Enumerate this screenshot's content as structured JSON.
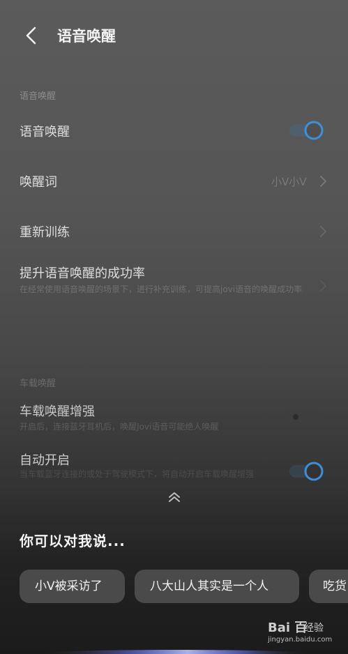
{
  "header": {
    "title": "语音唤醒"
  },
  "section_voice": {
    "label": "语音唤醒",
    "rows": [
      {
        "title": "语音唤醒",
        "toggle_on": true
      },
      {
        "title": "唤醒词",
        "value": "小V小V"
      },
      {
        "title": "重新训练"
      },
      {
        "title": "提升语音唤醒的成功率",
        "subtitle": "在经常使用语音唤醒的场景下，进行补充训练，可提高jovi语音的唤醒成功率"
      }
    ]
  },
  "section_car": {
    "label": "车载唤醒",
    "rows": [
      {
        "title": "车载唤醒增强",
        "subtitle": "开启后，连接蓝牙耳机后，唤醒Jovi语音可能绝人唤醒",
        "toggle_on": false
      },
      {
        "title": "自动开启",
        "subtitle": "当车载蓝牙连接的或处于驾驶模式下，将自动开启车载唤醒增强",
        "toggle_on": true
      }
    ]
  },
  "hint": {
    "title": "你可以对我说...",
    "chips": [
      "小V被采访了",
      "八大山人其实是一个人",
      "吃货"
    ]
  },
  "watermark": {
    "logo": "Bai 百",
    "brand": "经验",
    "url": "jingyan.baidu.com"
  },
  "colors": {
    "accent": "#3f8fd6",
    "background_top": "#5b5b5b",
    "background_bottom": "#1b1b1b"
  }
}
